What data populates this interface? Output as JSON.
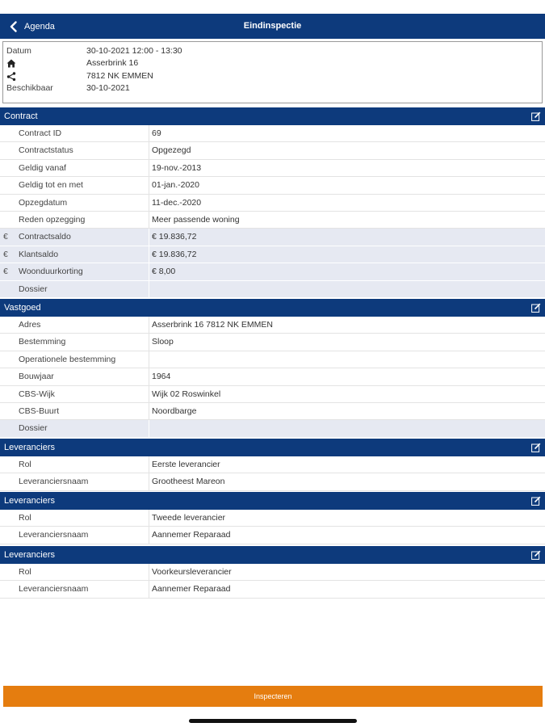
{
  "nav": {
    "back_label": "Agenda",
    "title": "Eindinspectie"
  },
  "info": {
    "datum_label": "Datum",
    "datum_value": "30-10-2021 12:00 - 13:30",
    "address": "Asserbrink 16",
    "postal": "7812 NK EMMEN",
    "beschikbaar_label": "Beschikbaar",
    "beschikbaar_value": "30-10-2021"
  },
  "contract": {
    "title": "Contract",
    "rows": [
      {
        "label": "Contract ID",
        "value": "69"
      },
      {
        "label": "Contractstatus",
        "value": "Opgezegd"
      },
      {
        "label": "Geldig vanaf",
        "value": "19-nov.-2013"
      },
      {
        "label": "Geldig tot en met",
        "value": "01-jan.-2020"
      },
      {
        "label": "Opzegdatum",
        "value": "11-dec.-2020"
      },
      {
        "label": "Reden opzegging",
        "value": "Meer passende woning"
      },
      {
        "label": "Contractsaldo",
        "value": "€ 19.836,72",
        "currency": "€"
      },
      {
        "label": "Klantsaldo",
        "value": "€ 19.836,72",
        "currency": "€"
      },
      {
        "label": "Woonduurkorting",
        "value": "€ 8,00",
        "currency": "€"
      },
      {
        "label": "Dossier",
        "value": ""
      }
    ]
  },
  "vastgoed": {
    "title": "Vastgoed",
    "rows": [
      {
        "label": "Adres",
        "value": "Asserbrink 16  7812 NK EMMEN"
      },
      {
        "label": "Bestemming",
        "value": "Sloop"
      },
      {
        "label": "Operationele bestemming",
        "value": ""
      },
      {
        "label": "Bouwjaar",
        "value": "1964"
      },
      {
        "label": "CBS-Wijk",
        "value": "Wijk 02 Roswinkel"
      },
      {
        "label": "CBS-Buurt",
        "value": "Noordbarge"
      },
      {
        "label": "Dossier",
        "value": ""
      }
    ]
  },
  "leveranciers1": {
    "title": "Leveranciers",
    "rows": [
      {
        "label": "Rol",
        "value": "Eerste leverancier"
      },
      {
        "label": "Leveranciersnaam",
        "value": "Grootheest Mareon"
      }
    ]
  },
  "leveranciers2": {
    "title": "Leveranciers",
    "rows": [
      {
        "label": "Rol",
        "value": "Tweede leverancier"
      },
      {
        "label": "Leveranciersnaam",
        "value": "Aannemer Reparaad"
      }
    ]
  },
  "leveranciers3": {
    "title": "Leveranciers",
    "rows": [
      {
        "label": "Rol",
        "value": "Voorkeursleverancier"
      },
      {
        "label": "Leveranciersnaam",
        "value": "Aannemer Reparaad"
      }
    ]
  },
  "cta": {
    "label": "Inspecteren"
  },
  "colors": {
    "header": "#0d3a7c",
    "highlight_row": "#e6e9f2",
    "cta": "#e57d0f"
  }
}
